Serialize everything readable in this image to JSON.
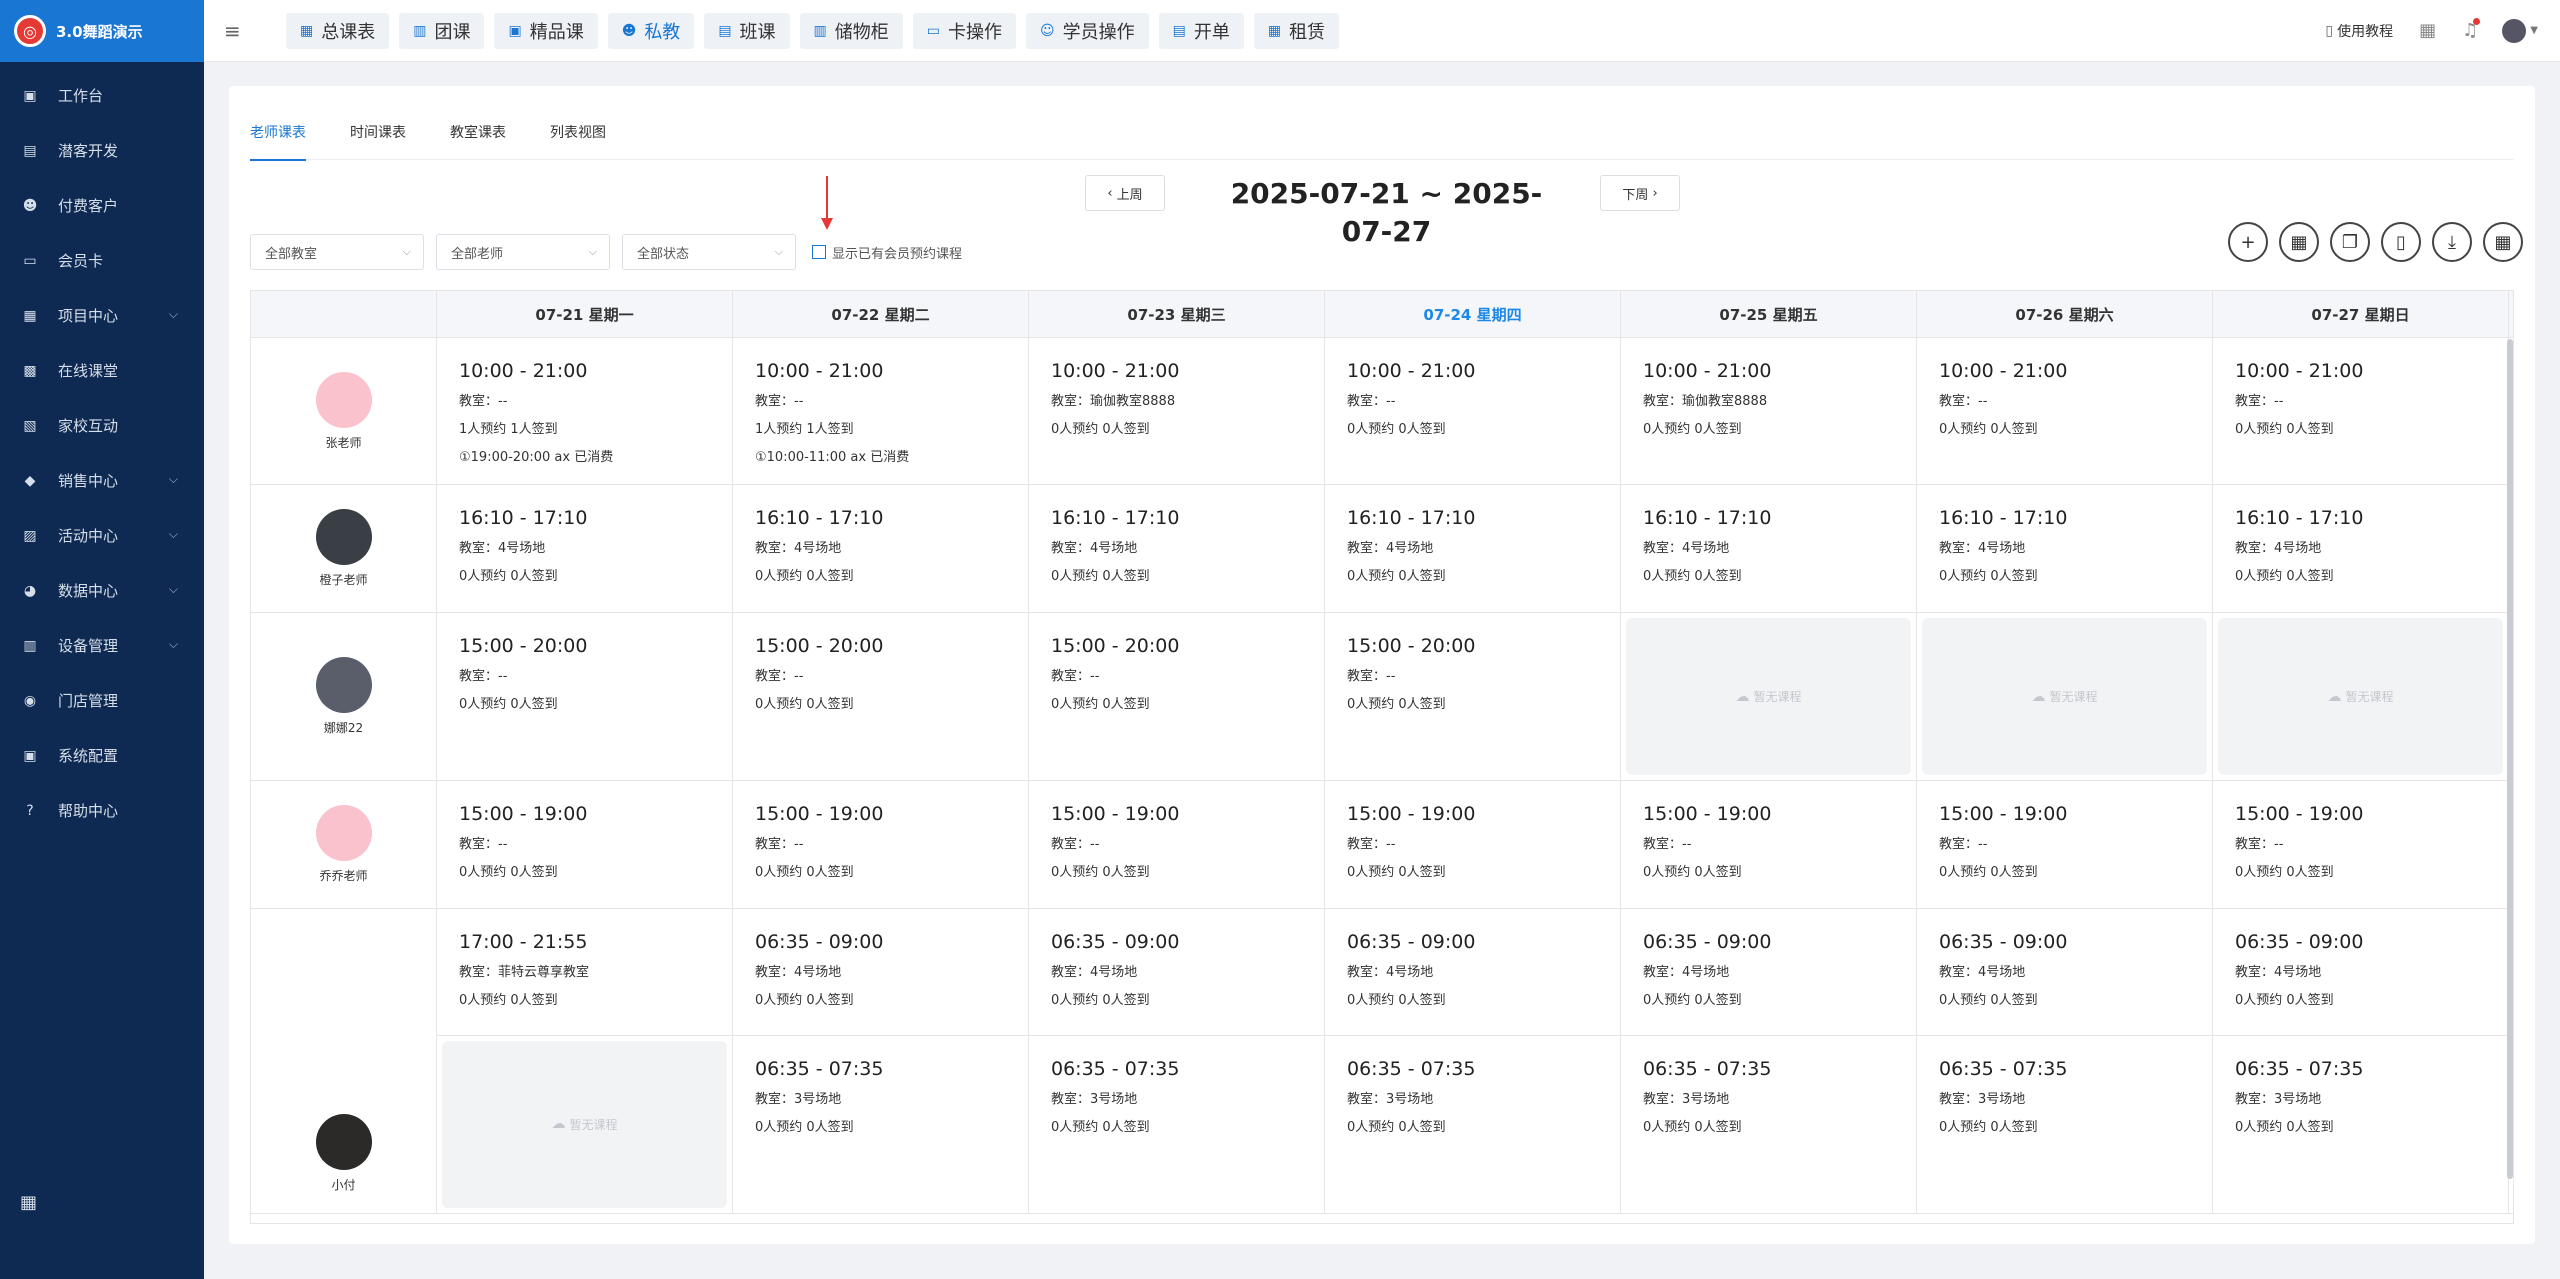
{
  "app": {
    "title": "3.0舞蹈演示",
    "logo_glyph": "◎"
  },
  "sidebar": {
    "items": [
      {
        "label": "工作台",
        "icon": "monitor-icon",
        "glyph": "▣",
        "expandable": false
      },
      {
        "label": "潜客开发",
        "icon": "id-card-icon",
        "glyph": "▤",
        "expandable": false
      },
      {
        "label": "付费客户",
        "icon": "users-icon",
        "glyph": "☻",
        "expandable": false
      },
      {
        "label": "会员卡",
        "icon": "card-icon",
        "glyph": "▭",
        "expandable": false
      },
      {
        "label": "项目中心",
        "icon": "folder-icon",
        "glyph": "▦",
        "expandable": true
      },
      {
        "label": "在线课堂",
        "icon": "calendar-icon",
        "glyph": "▩",
        "expandable": false
      },
      {
        "label": "家校互动",
        "icon": "contact-icon",
        "glyph": "▧",
        "expandable": false
      },
      {
        "label": "销售中心",
        "icon": "tag-icon",
        "glyph": "◆",
        "expandable": true
      },
      {
        "label": "活动中心",
        "icon": "activity-icon",
        "glyph": "▨",
        "expandable": true
      },
      {
        "label": "数据中心",
        "icon": "pie-chart-icon",
        "glyph": "◕",
        "expandable": true
      },
      {
        "label": "设备管理",
        "icon": "device-icon",
        "glyph": "▥",
        "expandable": true
      },
      {
        "label": "门店管理",
        "icon": "store-icon",
        "glyph": "◉",
        "expandable": false
      },
      {
        "label": "系统配置",
        "icon": "settings-icon",
        "glyph": "▣",
        "expandable": false
      },
      {
        "label": "帮助中心",
        "icon": "help-icon",
        "glyph": "?",
        "expandable": false
      }
    ]
  },
  "topbar": {
    "tabs": [
      {
        "label": "总课表",
        "icon": "calendar-icon",
        "glyph": "▦",
        "active": false
      },
      {
        "label": "团课",
        "icon": "book-icon",
        "glyph": "▥",
        "active": false
      },
      {
        "label": "精品课",
        "icon": "bookmark-icon",
        "glyph": "▣",
        "active": false
      },
      {
        "label": "私教",
        "icon": "users-icon",
        "glyph": "☻",
        "active": true
      },
      {
        "label": "班课",
        "icon": "classroom-icon",
        "glyph": "▤",
        "active": false
      },
      {
        "label": "储物柜",
        "icon": "locker-icon",
        "glyph": "▥",
        "active": false
      },
      {
        "label": "卡操作",
        "icon": "card-icon",
        "glyph": "▭",
        "active": false
      },
      {
        "label": "学员操作",
        "icon": "user-icon",
        "glyph": "☺",
        "active": false
      },
      {
        "label": "开单",
        "icon": "order-icon",
        "glyph": "▤",
        "active": false
      },
      {
        "label": "租赁",
        "icon": "building-icon",
        "glyph": "▦",
        "active": false
      }
    ],
    "help_label": "使用教程"
  },
  "view_tabs": [
    {
      "label": "老师课表",
      "active": true
    },
    {
      "label": "时间课表",
      "active": false
    },
    {
      "label": "教室课表",
      "active": false
    },
    {
      "label": "列表视图",
      "active": false
    }
  ],
  "week": {
    "prev_label": "上周",
    "next_label": "下周",
    "range": "2025-07-21 ~ 2025-07-27"
  },
  "filters": {
    "classroom": "全部教室",
    "teacher": "全部老师",
    "status": "全部状态",
    "checkbox_label": "显示已有会员预约课程"
  },
  "colors": {
    "accent": "#1976d2",
    "sidebar": "#0f2a52",
    "today": "#1e88e5",
    "arrow": "#e53935"
  },
  "days": [
    {
      "label": "07-21 星期一",
      "today": false
    },
    {
      "label": "07-22 星期二",
      "today": false
    },
    {
      "label": "07-23 星期三",
      "today": false
    },
    {
      "label": "07-24 星期四",
      "today": true
    },
    {
      "label": "07-25 星期五",
      "today": false
    },
    {
      "label": "07-26 星期六",
      "today": false
    },
    {
      "label": "07-27 星期日",
      "today": false
    }
  ],
  "empty_label": "暂无课程",
  "teachers": [
    {
      "name": "张老师",
      "avatar_color": "#f9c2cc",
      "rows": [
        [
          {
            "time": "10:00 - 21:00",
            "lines": [
              "教室：--",
              "1人预约 1人签到",
              "①19:00-20:00 ax 已消费"
            ]
          },
          {
            "time": "10:00 - 21:00",
            "lines": [
              "教室：--",
              "1人预约 1人签到",
              "①10:00-11:00 ax 已消费"
            ]
          },
          {
            "time": "10:00 - 21:00",
            "lines": [
              "教室：瑜伽教室8888",
              "0人预约 0人签到"
            ]
          },
          {
            "time": "10:00 - 21:00",
            "lines": [
              "教室：--",
              "0人预约 0人签到"
            ]
          },
          {
            "time": "10:00 - 21:00",
            "lines": [
              "教室：瑜伽教室8888",
              "0人预约 0人签到"
            ]
          },
          {
            "time": "10:00 - 21:00",
            "lines": [
              "教室：--",
              "0人预约 0人签到"
            ]
          },
          {
            "time": "10:00 - 21:00",
            "lines": [
              "教室：--",
              "0人预约 0人签到"
            ]
          }
        ]
      ]
    },
    {
      "name": "橙子老师",
      "avatar_color": "#3a3f46",
      "rows": [
        [
          {
            "time": "16:10 - 17:10",
            "lines": [
              "教室：4号场地",
              "0人预约 0人签到"
            ]
          },
          {
            "time": "16:10 - 17:10",
            "lines": [
              "教室：4号场地",
              "0人预约 0人签到"
            ]
          },
          {
            "time": "16:10 - 17:10",
            "lines": [
              "教室：4号场地",
              "0人预约 0人签到"
            ]
          },
          {
            "time": "16:10 - 17:10",
            "lines": [
              "教室：4号场地",
              "0人预约 0人签到"
            ]
          },
          {
            "time": "16:10 - 17:10",
            "lines": [
              "教室：4号场地",
              "0人预约 0人签到"
            ]
          },
          {
            "time": "16:10 - 17:10",
            "lines": [
              "教室：4号场地",
              "0人预约 0人签到"
            ]
          },
          {
            "time": "16:10 - 17:10",
            "lines": [
              "教室：4号场地",
              "0人预约 0人签到"
            ]
          }
        ]
      ]
    },
    {
      "name": "娜娜22",
      "avatar_color": "#5a5e6b",
      "rows": [
        [
          {
            "time": "15:00 - 20:00",
            "lines": [
              "教室：--",
              "0人预约 0人签到"
            ]
          },
          {
            "time": "15:00 - 20:00",
            "lines": [
              "教室：--",
              "0人预约 0人签到"
            ]
          },
          {
            "time": "15:00 - 20:00",
            "lines": [
              "教室：--",
              "0人预约 0人签到"
            ]
          },
          {
            "time": "15:00 - 20:00",
            "lines": [
              "教室：--",
              "0人预约 0人签到"
            ]
          },
          null,
          null,
          null
        ]
      ]
    },
    {
      "name": "乔乔老师",
      "avatar_color": "#f9c2cc",
      "rows": [
        [
          {
            "time": "15:00 - 19:00",
            "lines": [
              "教室：--",
              "0人预约 0人签到"
            ]
          },
          {
            "time": "15:00 - 19:00",
            "lines": [
              "教室：--",
              "0人预约 0人签到"
            ]
          },
          {
            "time": "15:00 - 19:00",
            "lines": [
              "教室：--",
              "0人预约 0人签到"
            ]
          },
          {
            "time": "15:00 - 19:00",
            "lines": [
              "教室：--",
              "0人预约 0人签到"
            ]
          },
          {
            "time": "15:00 - 19:00",
            "lines": [
              "教室：--",
              "0人预约 0人签到"
            ]
          },
          {
            "time": "15:00 - 19:00",
            "lines": [
              "教室：--",
              "0人预约 0人签到"
            ]
          },
          {
            "time": "15:00 - 19:00",
            "lines": [
              "教室：--",
              "0人预约 0人签到"
            ]
          }
        ]
      ]
    },
    {
      "name": "小付",
      "avatar_color": "#2c2a28",
      "rows": [
        [
          {
            "time": "17:00 - 21:55",
            "lines": [
              "教室：菲特云尊享教室",
              "0人预约 0人签到"
            ]
          },
          {
            "time": "06:35 - 09:00",
            "lines": [
              "教室：4号场地",
              "0人预约 0人签到"
            ]
          },
          {
            "time": "06:35 - 09:00",
            "lines": [
              "教室：4号场地",
              "0人预约 0人签到"
            ]
          },
          {
            "time": "06:35 - 09:00",
            "lines": [
              "教室：4号场地",
              "0人预约 0人签到"
            ]
          },
          {
            "time": "06:35 - 09:00",
            "lines": [
              "教室：4号场地",
              "0人预约 0人签到"
            ]
          },
          {
            "time": "06:35 - 09:00",
            "lines": [
              "教室：4号场地",
              "0人预约 0人签到"
            ]
          },
          {
            "time": "06:35 - 09:00",
            "lines": [
              "教室：4号场地",
              "0人预约 0人签到"
            ]
          }
        ],
        [
          null,
          {
            "time": "06:35 - 07:35",
            "lines": [
              "教室：3号场地",
              "0人预约 0人签到"
            ]
          },
          {
            "time": "06:35 - 07:35",
            "lines": [
              "教室：3号场地",
              "0人预约 0人签到"
            ]
          },
          {
            "time": "06:35 - 07:35",
            "lines": [
              "教室：3号场地",
              "0人预约 0人签到"
            ]
          },
          {
            "time": "06:35 - 07:35",
            "lines": [
              "教室：3号场地",
              "0人预约 0人签到"
            ]
          },
          {
            "time": "06:35 - 07:35",
            "lines": [
              "教室：3号场地",
              "0人预约 0人签到"
            ]
          },
          {
            "time": "06:35 - 07:35",
            "lines": [
              "教室：3号场地",
              "0人预约 0人签到"
            ]
          }
        ]
      ]
    }
  ]
}
